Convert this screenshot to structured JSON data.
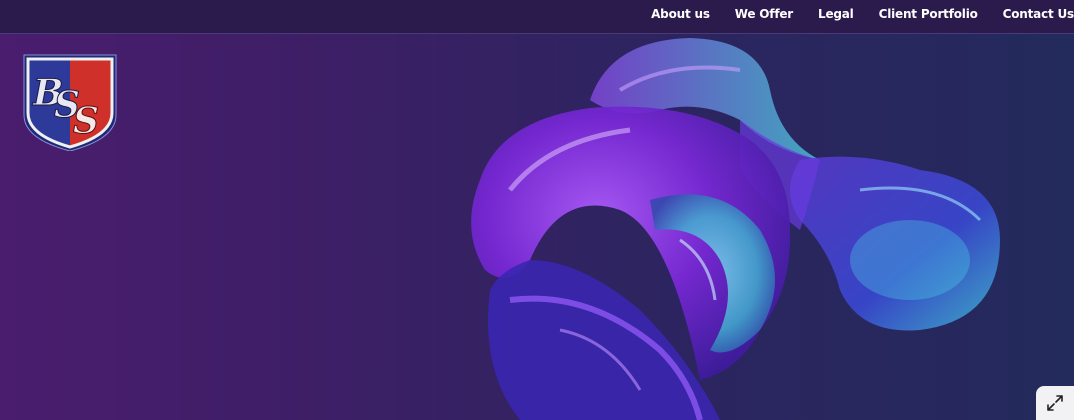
{
  "nav": {
    "items": [
      {
        "label": "About us"
      },
      {
        "label": "We Offer"
      },
      {
        "label": "Legal"
      },
      {
        "label": "Client Portfolio"
      },
      {
        "label": "Contact Us"
      }
    ]
  },
  "logo": {
    "text": "BSS",
    "colors": {
      "left": "#2d3a9a",
      "right": "#d0302a",
      "border": "#f0f0f0"
    }
  },
  "hero": {
    "art_icon": "abstract-3d-glass-shape",
    "colors": {
      "purple": "#8a2be2",
      "cyan": "#3fb6d0",
      "bg_left": "#4a1d6e",
      "bg_right": "#232a5c"
    }
  },
  "fullscreen": {
    "icon": "expand-icon"
  }
}
